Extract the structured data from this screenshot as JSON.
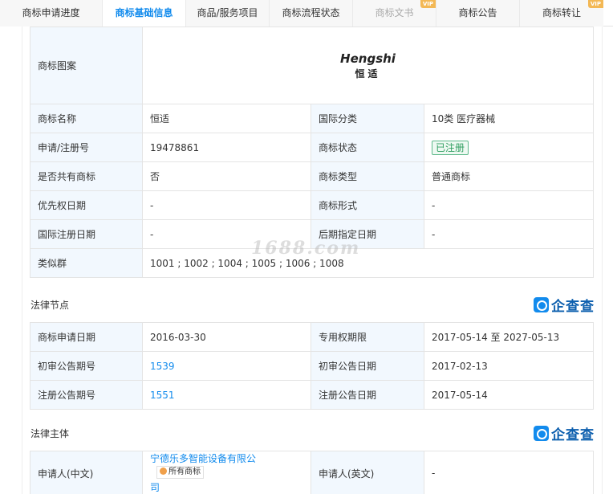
{
  "tabs": [
    {
      "label": "商标申请进度",
      "active": false
    },
    {
      "label": "商标基础信息",
      "active": true
    },
    {
      "label": "商品/服务项目",
      "active": false
    },
    {
      "label": "商标流程状态",
      "active": false
    },
    {
      "label": "商标文书",
      "active": false,
      "vip": "VIP",
      "disabled": true
    },
    {
      "label": "商标公告",
      "active": false
    },
    {
      "label": "商标转让",
      "active": false,
      "vip": "VIP"
    }
  ],
  "basic": {
    "pattern_label": "商标图案",
    "logo_en": "Hengshi",
    "logo_cn": "恒适",
    "name_label": "商标名称",
    "name": "恒适",
    "intl_class_label": "国际分类",
    "intl_class": "10类 医疗器械",
    "reg_no_label": "申请/注册号",
    "reg_no": "19478861",
    "status_label": "商标状态",
    "status": "已注册",
    "shared_label": "是否共有商标",
    "shared": "否",
    "type_label": "商标类型",
    "type": "普通商标",
    "priority_label": "优先权日期",
    "priority": "-",
    "form_label": "商标形式",
    "form": "-",
    "intl_reg_label": "国际注册日期",
    "intl_reg": "-",
    "later_label": "后期指定日期",
    "later": "-",
    "similar_label": "类似群",
    "similar": "1001 ; 1002 ; 1004 ; 1005 ; 1006 ; 1008"
  },
  "legal_nodes": {
    "title": "法律节点",
    "apply_date_label": "商标申请日期",
    "apply_date": "2016-03-30",
    "exclusive_label": "专用权期限",
    "exclusive": "2017-05-14 至 2027-05-13",
    "prelim_no_label": "初审公告期号",
    "prelim_no": "1539",
    "prelim_date_label": "初审公告日期",
    "prelim_date": "2017-02-13",
    "reg_pub_no_label": "注册公告期号",
    "reg_pub_no": "1551",
    "reg_pub_date_label": "注册公告日期",
    "reg_pub_date": "2017-05-14"
  },
  "legal_subject": {
    "title": "法律主体",
    "applicant_cn_label": "申请人(中文)",
    "applicant_cn_line1": "宁德乐多智能设备有限公",
    "applicant_cn_line2": "司",
    "owned_label": "所有商标",
    "applicant_en_label": "申请人(英文)",
    "applicant_en": "-"
  },
  "brand": {
    "name": "企查查",
    "icon": "qichacha-logo-icon",
    "color": "#128bed"
  },
  "watermark": "1688.com"
}
